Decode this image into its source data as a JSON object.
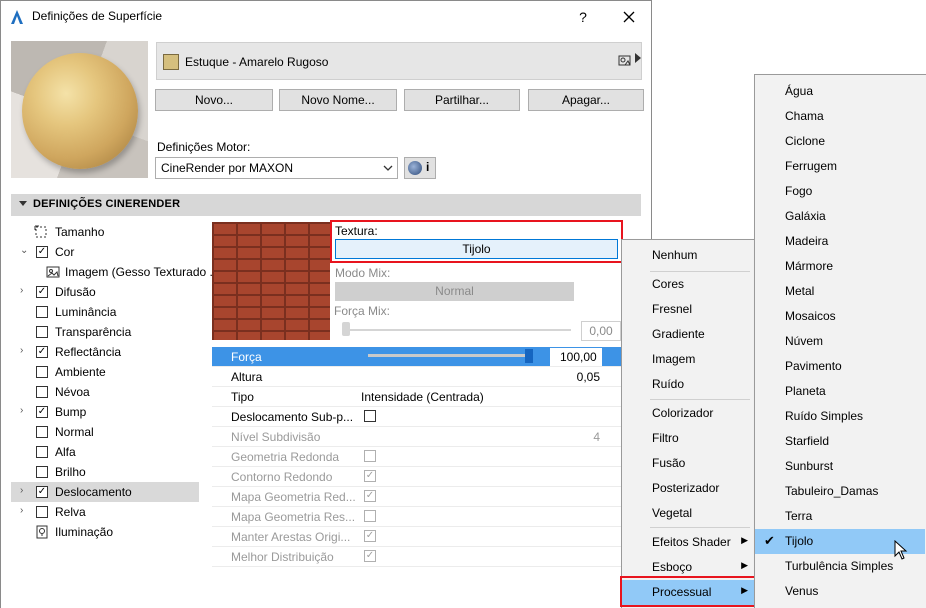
{
  "dialog": {
    "title": "Definições de Superfície",
    "help": "?",
    "close": "✕"
  },
  "material": {
    "name": "Estuque - Amarelo Rugoso",
    "swatch_color": "#d5bf7e"
  },
  "buttons": {
    "new": "Novo...",
    "new_name": "Novo Nome...",
    "share": "Partilhar...",
    "delete": "Apagar..."
  },
  "engine": {
    "label": "Definições Motor:",
    "value": "CineRender por MAXON",
    "info": "i"
  },
  "section": {
    "title": "DEFINIÇÕES CINERENDER"
  },
  "channels": [
    {
      "label": "Tamanho",
      "icon": "resize-icon",
      "checked": null,
      "expander": ""
    },
    {
      "label": "Cor",
      "checked": true,
      "expander": "v"
    },
    {
      "label": "Imagem (Gesso Texturado ...",
      "icon": "image-icon",
      "checked": null,
      "expander": "",
      "indent": true
    },
    {
      "label": "Difusão",
      "checked": true,
      "expander": ">"
    },
    {
      "label": "Luminância",
      "checked": false,
      "expander": ""
    },
    {
      "label": "Transparência",
      "checked": false,
      "expander": ""
    },
    {
      "label": "Reflectância",
      "checked": true,
      "expander": ">"
    },
    {
      "label": "Ambiente",
      "checked": false,
      "expander": ""
    },
    {
      "label": "Névoa",
      "checked": false,
      "expander": ""
    },
    {
      "label": "Bump",
      "checked": true,
      "expander": ">"
    },
    {
      "label": "Normal",
      "checked": false,
      "expander": ""
    },
    {
      "label": "Alfa",
      "checked": false,
      "expander": ""
    },
    {
      "label": "Brilho",
      "checked": false,
      "expander": ""
    },
    {
      "label": "Deslocamento",
      "checked": true,
      "expander": ">",
      "selected": true
    },
    {
      "label": "Relva",
      "checked": false,
      "expander": ">"
    },
    {
      "label": "Iluminação",
      "icon": "lightbulb-icon",
      "checked": null,
      "expander": ""
    }
  ],
  "texture": {
    "label": "Textura:",
    "value": "Tijolo",
    "mix_label": "Modo Mix:",
    "mix_value": "Normal",
    "mix_strength_label": "Força Mix:",
    "mix_strength_value": "0,00"
  },
  "properties": {
    "forca": {
      "label": "Força",
      "value": "100,00",
      "level": 1.0
    },
    "altura": {
      "label": "Altura",
      "value": "0,05"
    },
    "tipo": {
      "label": "Tipo",
      "value": "Intensidade (Centrada)"
    },
    "sub_poly": {
      "label": "Deslocamento Sub-p...",
      "checked": false
    },
    "nivel": {
      "label": "Nível Subdivisão",
      "value": "4"
    },
    "geometria_redonda": {
      "label": "Geometria Redonda",
      "checked": false
    },
    "contorno_redondo": {
      "label": "Contorno Redondo",
      "checked": true
    },
    "mapa_geometria_red": {
      "label": "Mapa Geometria Red...",
      "checked": true
    },
    "mapa_geometria_res": {
      "label": "Mapa Geometria Res...",
      "checked": false
    },
    "manter_arestas": {
      "label": "Manter Arestas Origi...",
      "checked": true
    },
    "melhor_distribuicao": {
      "label": "Melhor Distribuição",
      "checked": true
    }
  },
  "menu1": {
    "items": [
      "Nenhum",
      "Cores",
      "Fresnel",
      "Gradiente",
      "Imagem",
      "Ruído",
      "Colorizador",
      "Filtro",
      "Fusão",
      "Posterizador",
      "Vegetal",
      "Efeitos Shader",
      "Esboço",
      "Processual"
    ],
    "submenu_marker": "▶"
  },
  "menu2": {
    "items": [
      "Água",
      "Chama",
      "Ciclone",
      "Ferrugem",
      "Fogo",
      "Galáxia",
      "Madeira",
      "Mármore",
      "Metal",
      "Mosaicos",
      "Núvem",
      "Pavimento",
      "Planeta",
      "Ruído Simples",
      "Starfield",
      "Sunburst",
      "Tabuleiro_Damas",
      "Terra",
      "Tijolo",
      "Turbulência Simples",
      "Venus"
    ],
    "selected": "Tijolo",
    "check": "✔"
  },
  "colors": {
    "accent": "#3d93e6",
    "highlight_box": "#e8141e",
    "menu_selected": "#91c9f7"
  }
}
